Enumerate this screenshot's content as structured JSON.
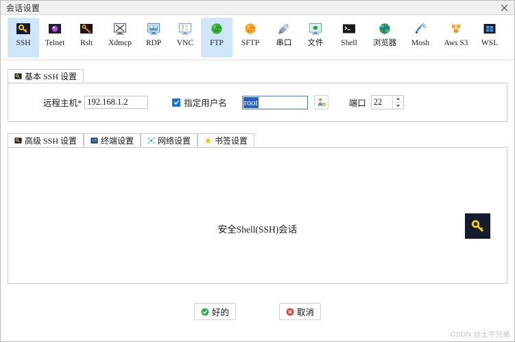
{
  "window": {
    "title": "会话设置",
    "close_icon": "close-icon"
  },
  "toolbar": {
    "items": [
      {
        "label": "SSH",
        "icon": "ssh-key-icon",
        "selected": true
      },
      {
        "label": "Telnet",
        "icon": "telnet-icon",
        "selected": false
      },
      {
        "label": "Rsh",
        "icon": "rsh-icon",
        "selected": false
      },
      {
        "label": "Xdmcp",
        "icon": "xdmcp-monitor-icon",
        "selected": false
      },
      {
        "label": "RDP",
        "icon": "rdp-monitor-icon",
        "selected": false
      },
      {
        "label": "VNC",
        "icon": "vnc-monitor-icon",
        "selected": false
      },
      {
        "label": "FTP",
        "icon": "ftp-globe-icon",
        "selected": true
      },
      {
        "label": "SFTP",
        "icon": "sftp-globe-icon",
        "selected": false
      },
      {
        "label": "串口",
        "icon": "serial-port-icon",
        "selected": false
      },
      {
        "label": "文件",
        "icon": "file-monitor-icon",
        "selected": false
      },
      {
        "label": "Shell",
        "icon": "shell-terminal-icon",
        "selected": false
      },
      {
        "label": "浏览器",
        "icon": "browser-globe-icon",
        "selected": false
      },
      {
        "label": "Mosh",
        "icon": "mosh-satellite-icon",
        "selected": false
      },
      {
        "label": "Aws S3",
        "icon": "aws-s3-icon",
        "selected": false
      },
      {
        "label": "WSL",
        "icon": "wsl-windows-icon",
        "selected": false
      }
    ]
  },
  "basic_tab": {
    "label": "基本 SSH 设置",
    "icon": "ssh-key-icon"
  },
  "form": {
    "host_label": "远程主机*",
    "host_value": "192.168.1.2",
    "specify_user_label": "指定用户名",
    "specify_user_checked": true,
    "user_value": "root",
    "user_picker_icon": "user-avatar-icon",
    "port_label": "端口",
    "port_value": "22",
    "spinner_up_icon": "chevron-up-icon",
    "spinner_down_icon": "chevron-down-icon"
  },
  "sub_tabs": [
    {
      "label": "高级 SSH 设置",
      "icon": "ssh-key-icon"
    },
    {
      "label": "终端设置",
      "icon": "terminal-icon"
    },
    {
      "label": "网络设置",
      "icon": "network-nodes-icon"
    },
    {
      "label": "书签设置",
      "icon": "star-icon"
    }
  ],
  "content": {
    "center_text": "安全Shell(SSH)会话",
    "key_icon": "key-icon"
  },
  "footer": {
    "ok_label": "好的",
    "ok_icon": "check-circle-icon",
    "cancel_label": "取消",
    "cancel_icon": "x-circle-icon"
  },
  "watermark": "CSDN @土牛兄弟",
  "colors": {
    "selection_blue": "#cfe6fa",
    "accent_blue": "#1574d4",
    "ok_green": "#2faa4c",
    "cancel_red": "#e03a3a",
    "key_yellow": "#f5c518"
  }
}
